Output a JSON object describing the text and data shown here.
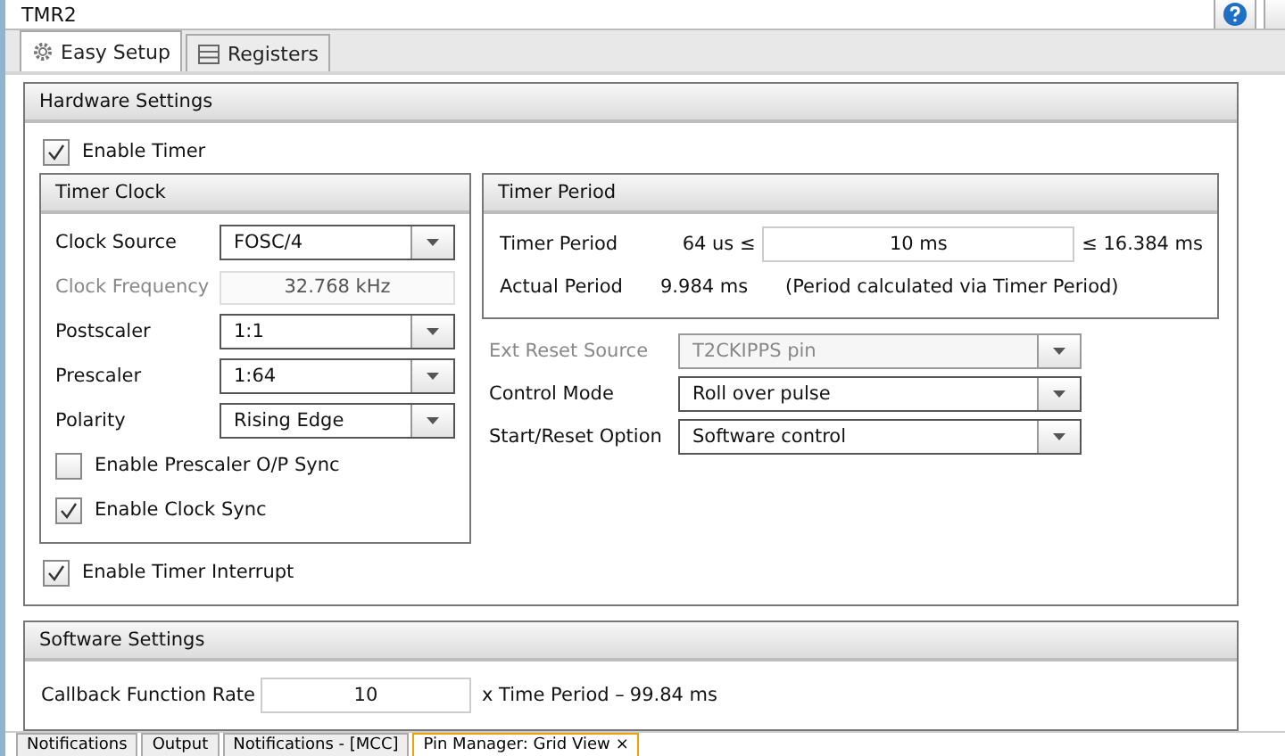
{
  "window": {
    "title": "TMR2"
  },
  "tabs": [
    {
      "label": "Easy Setup",
      "selected": true,
      "kind": "gear"
    },
    {
      "label": "Registers",
      "selected": false,
      "kind": "list"
    }
  ],
  "hardware_settings": {
    "title": "Hardware Settings",
    "enable_timer": {
      "label": "Enable Timer",
      "checked": true
    },
    "timer_clock": {
      "title": "Timer Clock",
      "fields": [
        {
          "kind": "dropdown",
          "label": "Clock Source",
          "value": "FOSC/4",
          "disabled": false
        },
        {
          "kind": "readout",
          "label": "Clock Frequency",
          "value": "32.768 kHz",
          "disabled": true
        },
        {
          "kind": "dropdown",
          "label": "Postscaler",
          "value": "1:1",
          "disabled": false
        },
        {
          "kind": "dropdown",
          "label": "Prescaler",
          "value": "1:64",
          "disabled": false
        },
        {
          "kind": "dropdown",
          "label": "Polarity",
          "value": "Rising Edge",
          "disabled": false
        }
      ],
      "checkboxes": [
        {
          "label": "Enable Prescaler O/P Sync",
          "checked": false
        },
        {
          "label": "Enable Clock Sync",
          "checked": true
        }
      ]
    },
    "timer_period": {
      "title": "Timer Period",
      "label": "Timer Period",
      "min": "64 us ≤",
      "value": "10 ms",
      "max": "≤ 16.384 ms",
      "actual_label": "Actual Period",
      "actual_value": "9.984 ms",
      "note": "(Period calculated via Timer Period)"
    },
    "reset_fields": [
      {
        "label": "Ext Reset Source",
        "value": "T2CKIPPS pin",
        "disabled": true
      },
      {
        "label": "Control Mode",
        "value": "Roll over pulse",
        "disabled": false
      },
      {
        "label": "Start/Reset Option",
        "value": "Software control",
        "disabled": false
      }
    ],
    "enable_interrupt": {
      "label": "Enable Timer Interrupt",
      "checked": true
    }
  },
  "software_settings": {
    "title": "Software Settings",
    "label": "Callback Function Rate",
    "value": "10",
    "suffix": "x Time Period –",
    "result": "99.84 ms"
  },
  "bottom_tabs": [
    {
      "label": "Notifications",
      "selected": false
    },
    {
      "label": "Output",
      "selected": false
    },
    {
      "label": "Notifications - [MCC]",
      "selected": false
    },
    {
      "label": "Pin Manager: Grid View",
      "selected": true,
      "close": "×"
    }
  ]
}
